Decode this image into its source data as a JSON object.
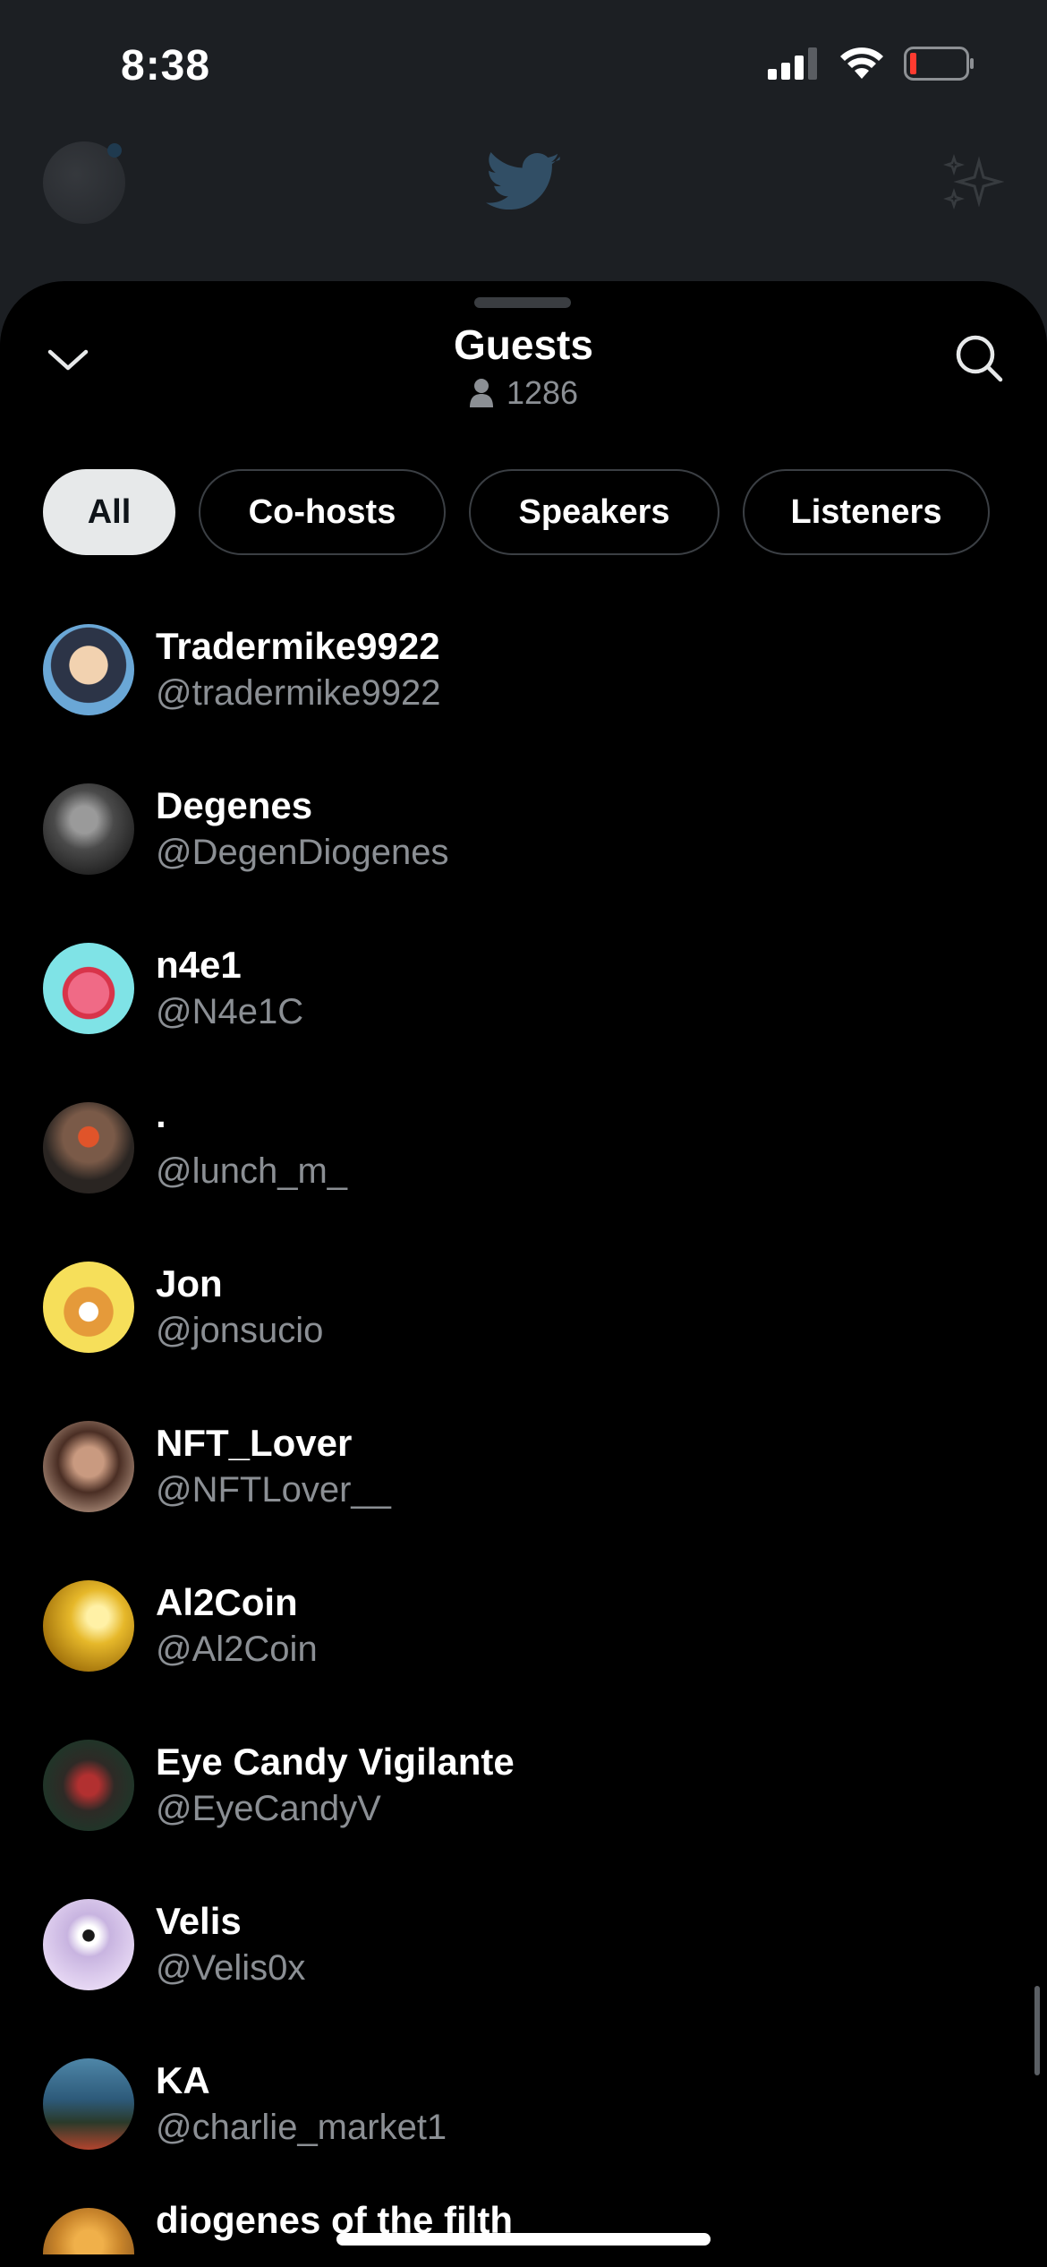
{
  "status_bar": {
    "time": "8:38"
  },
  "sheet": {
    "title": "Guests",
    "count": "1286"
  },
  "tabs": [
    {
      "label": "All",
      "active": true
    },
    {
      "label": "Co-hosts",
      "active": false
    },
    {
      "label": "Speakers",
      "active": false
    },
    {
      "label": "Listeners",
      "active": false
    }
  ],
  "guests": [
    {
      "name": "Tradermike9922",
      "handle": "@tradermike9922",
      "avatar_color": "#6aa7d6"
    },
    {
      "name": "Degenes",
      "handle": "@DegenDiogenes",
      "avatar_color": "#5e5e5e"
    },
    {
      "name": "n4e1",
      "handle": "@N4e1C",
      "avatar_color": "#7fe3e6"
    },
    {
      "name": "·",
      "handle": "@lunch_m_",
      "avatar_color": "#3b3530"
    },
    {
      "name": "Jon",
      "handle": "@jonsucio",
      "avatar_color": "#f6df5a"
    },
    {
      "name": "NFT_Lover",
      "handle": "@NFTLover__",
      "avatar_color": "#8a6a58"
    },
    {
      "name": "Al2Coin",
      "handle": "@Al2Coin",
      "avatar_color": "#d4a514"
    },
    {
      "name": "Eye Candy Vigilante",
      "handle": "@EyeCandyV",
      "avatar_color": "#3a2e2b"
    },
    {
      "name": "Velis",
      "handle": "@Velis0x",
      "avatar_color": "#d9c7ee"
    },
    {
      "name": "KA",
      "handle": "@charlie_market1",
      "avatar_color": "#2d5a7a"
    },
    {
      "name": "diogenes of the filth",
      "handle": "",
      "avatar_color": "#c9852b"
    }
  ],
  "colors": {
    "background": "#000000",
    "handle_text": "#8b8f94",
    "active_tab_bg": "#e7e9ea",
    "tab_border": "#3b3f44"
  },
  "icons": {
    "collapse": "chevron-down-icon",
    "search": "search-icon",
    "count": "person-icon",
    "app_logo": "twitter-bird-icon",
    "sparkle": "sparkle-icon"
  }
}
